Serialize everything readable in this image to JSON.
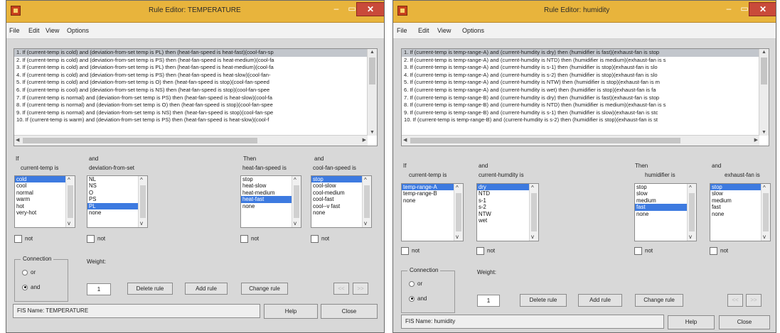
{
  "windows": [
    {
      "title": "Rule Editor: TEMPERATURE",
      "menus": [
        "File",
        "Edit",
        "View",
        "Options"
      ],
      "rules": [
        "1. If (current-temp is cold) and (deviation-from-set temp is PL) then (heat-fan-speed is heat-fast)(cool-fan-sp",
        "2. If (current-temp is cold) and (deviation-from-set temp is PS) then (heat-fan-speed is heat-medium)(cool-fa",
        "3. If (current-temp is cold) and (deviation-from-set temp is PL) then (heat-fan-speed is heat-medium)(cool-fa",
        "4. If (current-temp is cold) and (deviation-from-set temp is PS) then (heat-fan-speed is heat-slow)(cool-fan-",
        "5. If (current-temp is cold) and (deviation-from-set temp is O) then (heat-fan-speed is stop)(cool-fan-speed",
        "6. If (current-temp is cool) and (deviation-from-set temp is NS) then (heat-fan-speed is stop)(cool-fan-spee",
        "7. If (current-temp is normal) and (deviation-from-set temp is PS) then (heat-fan-speed is heat-slow)(cool-fa",
        "8. If (current-temp is normal) and (deviation-from-set temp is O) then (heat-fan-speed is stop)(cool-fan-spee",
        "9. If (current-temp is normal) and (deviation-from-set temp is NS) then (heat-fan-speed is stop)(cool-fan-spe",
        "10. If (current-temp is warm) and (deviation-from-set temp is PS) then (heat-fan-speed is heat-slow)(cool-f"
      ],
      "col1": {
        "top": "If",
        "sub": "current-temp is",
        "items": [
          "cold",
          "cool",
          "normal",
          "warm",
          "hot",
          "very-hot"
        ],
        "selected": 0
      },
      "col2": {
        "top": "and",
        "sub": "deviation-from-set",
        "items": [
          "NL",
          "NS",
          "O",
          "PS",
          "PL",
          "none"
        ],
        "selected": 4
      },
      "col3": {
        "top": "Then",
        "sub": "heat-fan-speed is",
        "items": [
          "stop",
          "heat-slow",
          "heat-medium",
          "heat-fast",
          "none"
        ],
        "selected": 3
      },
      "col4": {
        "top": "and",
        "sub": "cool-fan-speed is",
        "items": [
          "stop",
          "cool-slow",
          "cool-medium",
          "cool-fast",
          "cool--v fast",
          "none"
        ],
        "selected": 0
      },
      "not_label": "not",
      "connection": {
        "label": "Connection",
        "or": "or",
        "and": "and",
        "selected": "and"
      },
      "weight_label": "Weight:",
      "weight_value": "1",
      "buttons": {
        "delete": "Delete rule",
        "add": "Add rule",
        "change": "Change rule",
        "prev": "<<",
        "next": ">>"
      },
      "status": "FIS Name: TEMPERATURE",
      "help": "Help",
      "close": "Close"
    },
    {
      "title": "Rule Editor: humidity",
      "menus": [
        "File",
        "Edit",
        "View",
        "Options"
      ],
      "rules": [
        "1. If (current-temp is temp-range-A) and (current-humdity is dry) then (humidifier is fast)(exhaust-fan is stop",
        "2. If (current-temp is temp-range-A) and (current-humdity is NTD) then (humidifier is medium)(exhaust-fan is s",
        "3. If (current-temp is temp-range-A) and (current-humdity is s-1) then (humidifier is stop)(exhaust-fan is slo",
        "4. If (current-temp is temp-range-A) and (current-humdity is s-2) then (humidifier is stop)(exhaust-fan is slo",
        "5. If (current-temp is temp-range-A) and (current-humdity is NTW) then (humidifier is stop)(exhaust-fan is m",
        "6. If (current-temp is temp-range-A) and (current-humdity is wet) then (humidifier is stop)(exhaust-fan is fa",
        "7. If (current-temp is temp-range-B) and (current-humdity is dry) then (humidifier is fast)(exhaust-fan is stop",
        "8. If (current-temp is temp-range-B) and (current-humdity is NTD) then (humidifier is medium)(exhaust-fan is s",
        "9. If (current-temp is temp-range-B) and (current-humdity is s-1) then (humidifier is slow)(exhaust-fan is stc",
        "10. If (current-temp is temp-range-B) and (current-humdity is s-2) then (humidifier is stop)(exhaust-fan is st"
      ],
      "col1": {
        "top": "If",
        "sub": "current-temp is",
        "items": [
          "temp-range-A",
          "temp-range-B",
          "none"
        ],
        "selected": 0
      },
      "col2": {
        "top": "and",
        "sub": "current-humdity is",
        "items": [
          "dry",
          "NTD",
          "s-1",
          "s-2",
          "NTW",
          "wet"
        ],
        "selected": 0
      },
      "col3": {
        "top": "Then",
        "sub": "humidifier is",
        "items": [
          "stop",
          "slow",
          "medium",
          "fast",
          "none"
        ],
        "selected": 3
      },
      "col4": {
        "top": "and",
        "sub": "exhaust-fan is",
        "items": [
          "stop",
          "slow",
          "medium",
          "fast",
          "none"
        ],
        "selected": 0
      },
      "not_label": "not",
      "connection": {
        "label": "Connection",
        "or": "or",
        "and": "and",
        "selected": "and"
      },
      "weight_label": "Weight:",
      "weight_value": "1",
      "buttons": {
        "delete": "Delete rule",
        "add": "Add rule",
        "change": "Change rule",
        "prev": "<<",
        "next": ">>"
      },
      "status": "FIS Name: humidity",
      "help": "Help",
      "close": "Close"
    }
  ]
}
